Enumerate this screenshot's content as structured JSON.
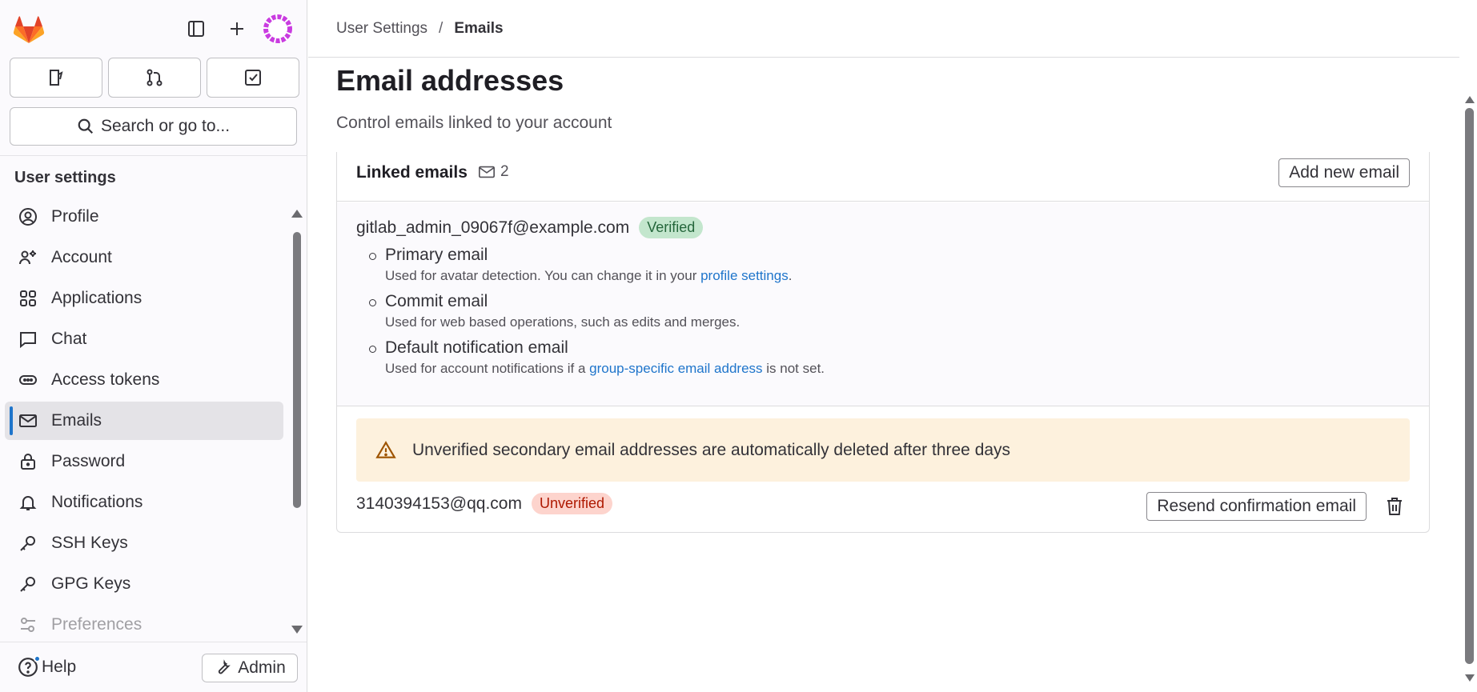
{
  "sidebar": {
    "search_label": "Search or go to...",
    "heading": "User settings",
    "items": [
      {
        "label": "Profile",
        "icon": "profile-icon"
      },
      {
        "label": "Account",
        "icon": "account-icon"
      },
      {
        "label": "Applications",
        "icon": "applications-icon"
      },
      {
        "label": "Chat",
        "icon": "chat-icon"
      },
      {
        "label": "Access tokens",
        "icon": "token-icon"
      },
      {
        "label": "Emails",
        "icon": "mail-icon",
        "active": true
      },
      {
        "label": "Password",
        "icon": "lock-icon"
      },
      {
        "label": "Notifications",
        "icon": "bell-icon"
      },
      {
        "label": "SSH Keys",
        "icon": "key-icon"
      },
      {
        "label": "GPG Keys",
        "icon": "key-icon"
      },
      {
        "label": "Preferences",
        "icon": "preferences-icon"
      }
    ],
    "help_label": "Help",
    "admin_label": "Admin"
  },
  "breadcrumbs": {
    "parent": "User Settings",
    "separator": "/",
    "current": "Emails"
  },
  "page": {
    "title": "Email addresses",
    "subtitle": "Control emails linked to your account"
  },
  "linked_emails": {
    "title": "Linked emails",
    "count": "2",
    "add_button": "Add new email",
    "primary": {
      "address": "gitlab_admin_09067f@example.com",
      "badge": "Verified",
      "roles": [
        {
          "name": "Primary email",
          "desc_before": "Used for avatar detection. You can change it in your ",
          "link": "profile settings",
          "desc_after": "."
        },
        {
          "name": "Commit email",
          "desc_before": "Used for web based operations, such as edits and merges.",
          "link": "",
          "desc_after": ""
        },
        {
          "name": "Default notification email",
          "desc_before": "Used for account notifications if a ",
          "link": "group-specific email address",
          "desc_after": " is not set."
        }
      ]
    },
    "alert": "Unverified secondary email addresses are automatically deleted after three days",
    "secondary": {
      "address": "3140394153@qq.com",
      "badge": "Unverified",
      "resend_button": "Resend confirmation email"
    }
  },
  "colors": {
    "accent": "#1f75cb",
    "verified_bg": "#c3e6cd",
    "unverified_bg": "#fdd4cd",
    "alert_bg": "#fdf1dd"
  }
}
